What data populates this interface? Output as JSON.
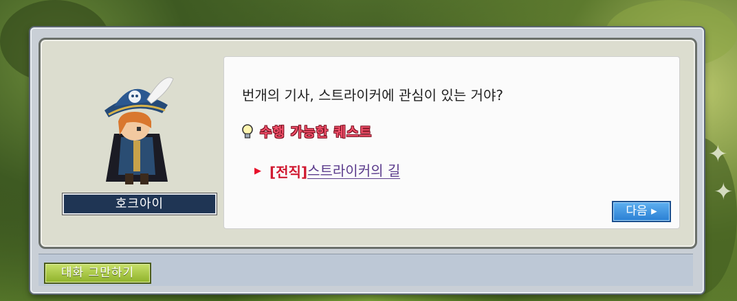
{
  "npc": {
    "name": "호크아이"
  },
  "dialog": {
    "question": "번개의 기사, 스트라이커에 관심이 있는 거야?",
    "quest_header": "수행 가능한 퀘스트",
    "quests": [
      {
        "tag": "[전직]",
        "name": "스트라이커의 길"
      }
    ],
    "next_label": "다음 ▸"
  },
  "footer": {
    "end_chat_label": "대화 그만하기"
  },
  "icons": {
    "quest_header": "lightbulb-icon",
    "quest_item": "arrow-right-icon"
  },
  "colors": {
    "quest_header": "#f0506a",
    "quest_tag": "#d01830",
    "quest_name": "#5b3b8c",
    "next_button": "#2a7fd3",
    "end_button": "#8fb22a"
  }
}
